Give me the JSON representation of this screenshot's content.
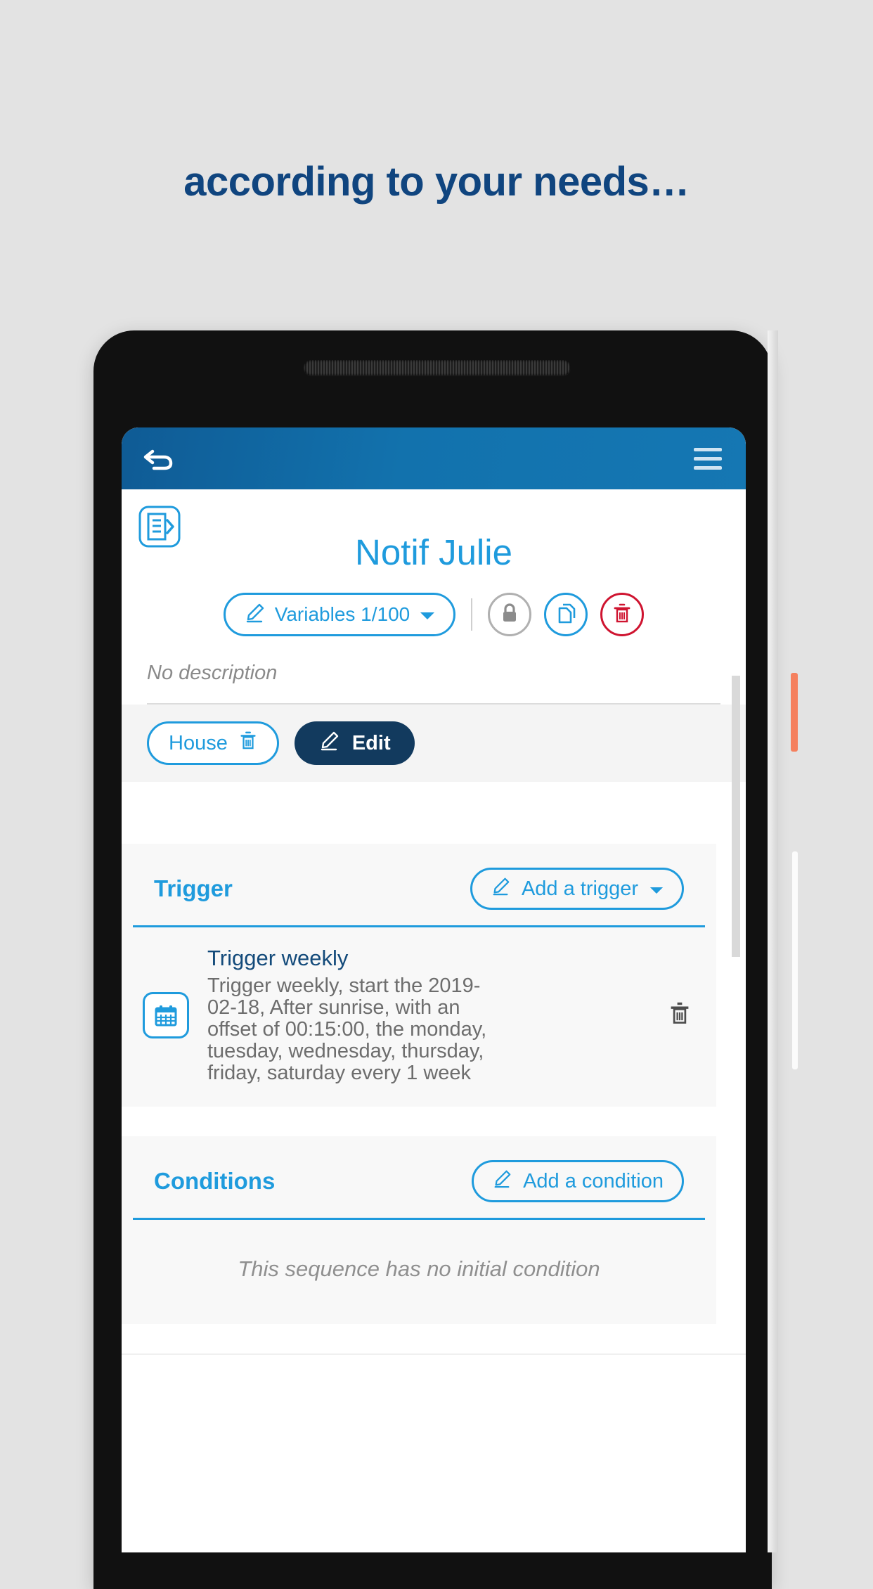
{
  "page": {
    "headline": "according to your needs…",
    "background_color": "#e3e3e3",
    "headline_color": "#10457f"
  },
  "device": {
    "frame_color": "#111111",
    "power_button_color": "#f5805e",
    "volume_button_color": "#fbfbfb"
  },
  "appbar": {
    "back_icon": "back-arrow-icon",
    "menu_icon": "hamburger-menu-icon",
    "background_start": "#0f5b95",
    "background_end": "#1577b3"
  },
  "header": {
    "script_icon": "script-document-icon",
    "title": "Notif Julie",
    "title_color": "#1f9bdd"
  },
  "actions": {
    "variables": {
      "label": "Variables 1/100",
      "icon": "pencil-icon",
      "dropdown_icon": "caret-down-icon",
      "color": "#1f9bdd"
    },
    "lock": {
      "icon": "lock-icon",
      "color": "#b0b0b0"
    },
    "duplicate": {
      "icon": "copy-document-icon",
      "color": "#1f9bdd"
    },
    "delete": {
      "icon": "trash-icon",
      "color": "#cf1430"
    }
  },
  "description": {
    "text": "No description"
  },
  "chips": {
    "house": {
      "label": "House",
      "icon": "trash-icon"
    },
    "edit": {
      "label": "Edit",
      "icon": "pencil-icon",
      "background": "#123a5e"
    }
  },
  "trigger_section": {
    "title": "Trigger",
    "add_button": {
      "label": "Add a trigger",
      "icon": "pencil-icon",
      "dropdown_icon": "caret-down-icon"
    },
    "items": [
      {
        "icon": "calendar-icon",
        "title": "Trigger weekly",
        "description": "Trigger weekly, start the 2019-02-18, After sunrise, with an offset of 00:15:00, the monday, tuesday, wednesday, thursday, friday, saturday every 1 week",
        "delete_icon": "trash-icon"
      }
    ]
  },
  "conditions_section": {
    "title": "Conditions",
    "add_button": {
      "label": "Add a condition",
      "icon": "pencil-icon"
    },
    "empty_text": "This sequence has no initial condition"
  }
}
